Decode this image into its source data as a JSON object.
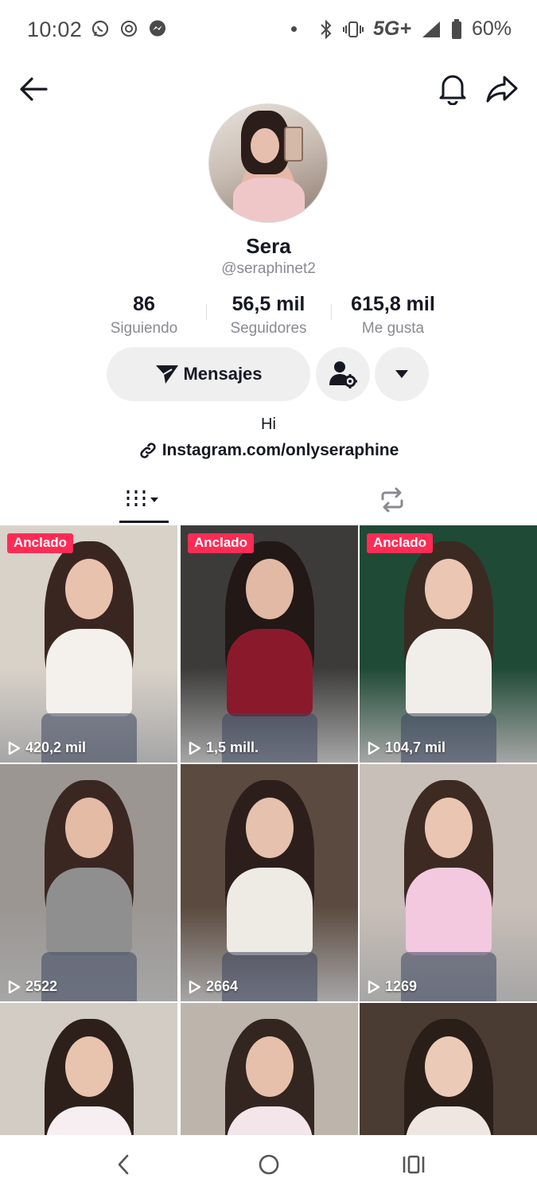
{
  "status_bar": {
    "time": "10:02",
    "network": "5G+",
    "battery": "60%",
    "icons": [
      "whatsapp-icon",
      "screen-record-icon",
      "messenger-icon",
      "bluetooth-icon",
      "vibrate-icon",
      "signal-icon",
      "battery-icon"
    ]
  },
  "header": {
    "back_icon": "arrow-left-icon",
    "bell_icon": "bell-icon",
    "share_icon": "share-arrow-icon"
  },
  "profile": {
    "display_name": "Sera",
    "username": "@seraphinet2",
    "stats": [
      {
        "value": "86",
        "label": "Siguiendo"
      },
      {
        "value": "56,5 mil",
        "label": "Seguidores"
      },
      {
        "value": "615,8 mil",
        "label": "Me gusta"
      }
    ],
    "message_button": "Mensajes",
    "bio": "Hi",
    "link": "Instagram.com/onlyseraphine"
  },
  "tabs": [
    {
      "icon": "videos-grid-icon",
      "active": true
    },
    {
      "icon": "repost-icon",
      "active": false
    }
  ],
  "videos": [
    {
      "pinned": "Anclado",
      "views": "420,2 mil",
      "bg": "#d9d2c9",
      "hair": "#3a2620",
      "top": "#f4f1ec",
      "skin": "#e9c2ae"
    },
    {
      "pinned": "Anclado",
      "views": "1,5 mill.",
      "bg": "#3c3b3a",
      "hair": "#221815",
      "top": "#8a1a2b",
      "skin": "#e2b9a4"
    },
    {
      "pinned": "Anclado",
      "views": "104,7 mil",
      "bg": "#1f4a36",
      "hair": "#3b2a22",
      "top": "#f1eeea",
      "skin": "#eac6b3"
    },
    {
      "pinned": "",
      "views": "2522",
      "bg": "#9b9692",
      "hair": "#3a2722",
      "top": "#8f8f8f",
      "skin": "#e4bba5"
    },
    {
      "pinned": "",
      "views": "2664",
      "bg": "#5b4a3f",
      "hair": "#2c1f1b",
      "top": "#eeeae4",
      "skin": "#e6c1ad"
    },
    {
      "pinned": "",
      "views": "1269",
      "bg": "#c8bfb8",
      "hair": "#3d2a22",
      "top": "#f2c9de",
      "skin": "#eac6b2"
    },
    {
      "pinned": "",
      "views": "",
      "bg": "#d2ccc5",
      "hair": "#2d201b",
      "top": "#f6eef0",
      "skin": "#e8c3ae"
    },
    {
      "pinned": "",
      "views": "",
      "bg": "#bdb4ab",
      "hair": "#332520",
      "top": "#f3e5ea",
      "skin": "#e7c0ab"
    },
    {
      "pinned": "",
      "views": "",
      "bg": "#4a3c33",
      "hair": "#2a1e19",
      "top": "#efe6e1",
      "skin": "#eccab8"
    }
  ],
  "nav_bar": {
    "back_icon": "nav-back-icon",
    "home_icon": "nav-home-icon",
    "recents_icon": "nav-recents-icon"
  },
  "colors": {
    "accent": "#fe2c55",
    "text": "#161823",
    "muted": "#8a8b91",
    "button_bg": "#efeff0"
  }
}
